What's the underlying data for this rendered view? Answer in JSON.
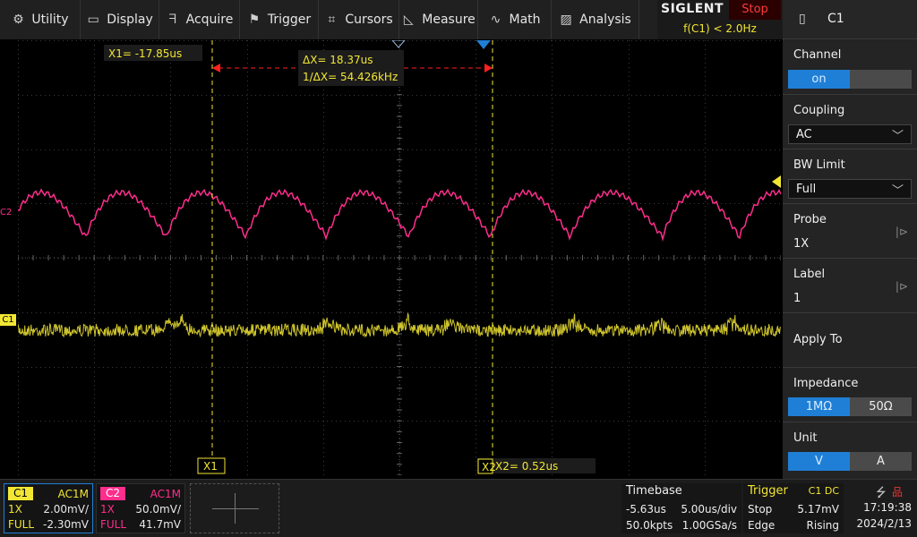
{
  "menu": [
    {
      "label": "Utility",
      "icon": "gear-icon",
      "glyph": "⚙",
      "w": 90
    },
    {
      "label": "Display",
      "icon": "monitor-icon",
      "glyph": "▭",
      "w": 88
    },
    {
      "label": "Acquire",
      "icon": "acquire-icon",
      "glyph": "ᖷ",
      "w": 90
    },
    {
      "label": "Trigger",
      "icon": "flag-icon",
      "glyph": "⚑",
      "w": 88
    },
    {
      "label": "Cursors",
      "icon": "cursor-crosshair-icon",
      "glyph": "⌗",
      "w": 90
    },
    {
      "label": "Measure",
      "icon": "measure-icon",
      "glyph": "◺",
      "w": 88
    },
    {
      "label": "Math",
      "icon": "math-icon",
      "glyph": "∿",
      "w": 82
    },
    {
      "label": "Analysis",
      "icon": "analysis-icon",
      "glyph": "▨",
      "w": 98
    }
  ],
  "brand": {
    "name": "SIGLENT",
    "state": "Stop",
    "trigger_freq": "f(C1) < 2.0Hz"
  },
  "panel": {
    "title": "C1",
    "channel": {
      "label": "Channel",
      "options": [
        "on",
        ""
      ]
    },
    "coupling": {
      "label": "Coupling",
      "value": "AC"
    },
    "bw_limit": {
      "label": "BW Limit",
      "value": "Full"
    },
    "probe": {
      "label": "Probe",
      "value": "1X"
    },
    "label": {
      "label": "Label",
      "value": "1"
    },
    "apply_to": "Apply To",
    "impedance": {
      "label": "Impedance",
      "options": [
        "1MΩ",
        "50Ω"
      ]
    },
    "unit": {
      "label": "Unit",
      "options": [
        "V",
        "A"
      ]
    }
  },
  "cursors": {
    "x1_readout": "X1= -17.85us",
    "x2_readout": "X2= 0.52us",
    "delta": "ΔX= 18.37us",
    "inv_delta": "1/ΔX= 54.426kHz",
    "x1_tag": "X1",
    "x2_tag": "X2"
  },
  "markers": {
    "c1": "C1",
    "c2": "C2"
  },
  "channels": [
    {
      "name": "C1",
      "coupling": "AC1M",
      "probe": "1X",
      "scale": "2.00mV/",
      "bw": "FULL",
      "offset": "-2.30mV",
      "color": "#f2e634"
    },
    {
      "name": "C2",
      "coupling": "AC1M",
      "probe": "1X",
      "scale": "50.0mV/",
      "bw": "FULL",
      "offset": "41.7mV",
      "color": "#ff2d8c"
    }
  ],
  "timebase": {
    "label": "Timebase",
    "delay": "-5.63us",
    "scale": "5.00us/div",
    "points": "50.0kpts",
    "rate": "1.00GSa/s"
  },
  "trigger": {
    "label": "Trigger",
    "source": "C1 DC",
    "mode": "Stop",
    "level": "5.17mV",
    "type": "Edge",
    "slope": "Rising"
  },
  "clock": {
    "time": "17:19:38",
    "date": "2024/2/13"
  },
  "colors": {
    "c1": "#f2e634",
    "c2": "#ff2d8c",
    "accent": "#1f7fd6",
    "cursor": "#f2e634",
    "delta_marker": "#ff2020"
  }
}
